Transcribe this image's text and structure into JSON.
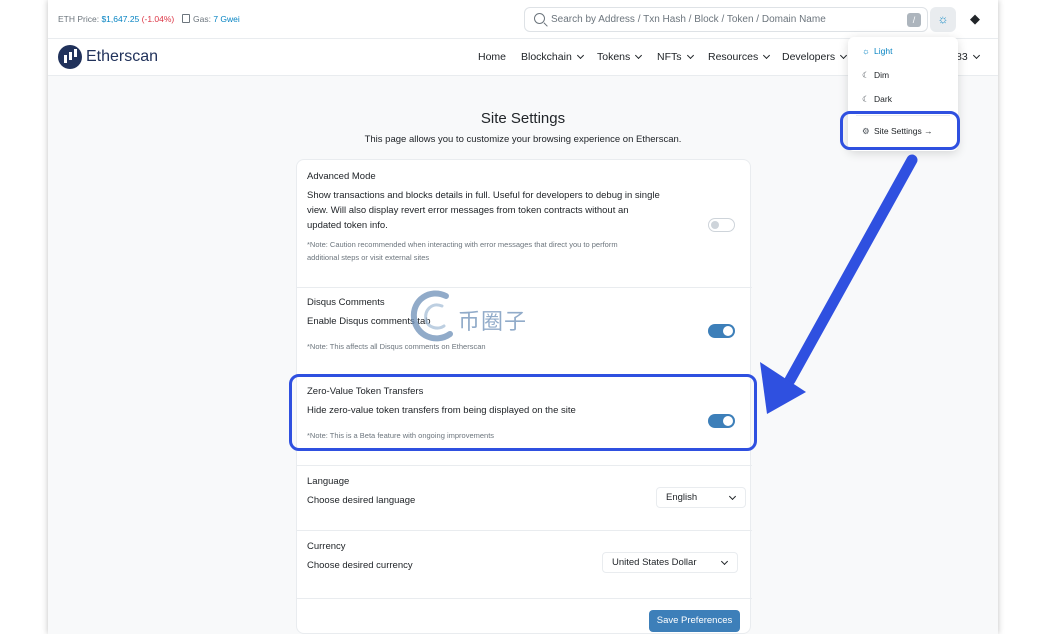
{
  "topbar": {
    "eth_price_label": "ETH Price: ",
    "eth_price_value": "$1,647.25",
    "eth_price_change": "(-1.04%)",
    "gas_label": "Gas: ",
    "gas_value": "7 Gwei",
    "search_placeholder": "Search by Address / Txn Hash / Block / Token / Domain Name",
    "slash_key": "/"
  },
  "brand": {
    "name": "Etherscan"
  },
  "nav": {
    "items": [
      "Home",
      "Blockchain",
      "Tokens",
      "NFTs",
      "Resources",
      "Developers"
    ],
    "tail": "83"
  },
  "theme_menu": {
    "light": "Light",
    "dim": "Dim",
    "dark": "Dark",
    "site_settings": "Site Settings"
  },
  "page": {
    "title": "Site Settings",
    "subtitle": "This page allows you to customize your browsing experience on Etherscan."
  },
  "settings": {
    "advanced": {
      "title": "Advanced Mode",
      "desc_lines": [
        "Show transactions and blocks details in full. Useful for developers to debug in single",
        "view. Will also display revert error messages from token contracts without an",
        "updated token info."
      ],
      "note_lines": [
        "*Note: Caution recommended when interacting with error messages that direct you to perform",
        "additional steps or visit external sites"
      ],
      "enabled": false
    },
    "disqus": {
      "title": "Disqus Comments",
      "desc": "Enable Disqus comments tab",
      "note": "*Note: This affects all Disqus comments on Etherscan",
      "enabled": true
    },
    "zero_value": {
      "title": "Zero-Value Token Transfers",
      "desc": "Hide zero-value token transfers from being displayed on the site",
      "note": "*Note: This is a Beta feature with ongoing improvements",
      "enabled": true
    },
    "language": {
      "title": "Language",
      "desc": "Choose desired language",
      "selected": "English"
    },
    "currency": {
      "title": "Currency",
      "desc": "Choose desired currency",
      "selected": "United States Dollar"
    },
    "save_label": "Save Preferences"
  },
  "watermark": {
    "text": "币圈子"
  },
  "colors": {
    "accent": "#0784c3",
    "toggle_on": "#3d7fb9",
    "annotation": "#2f50e0",
    "brand": "#21325b"
  }
}
